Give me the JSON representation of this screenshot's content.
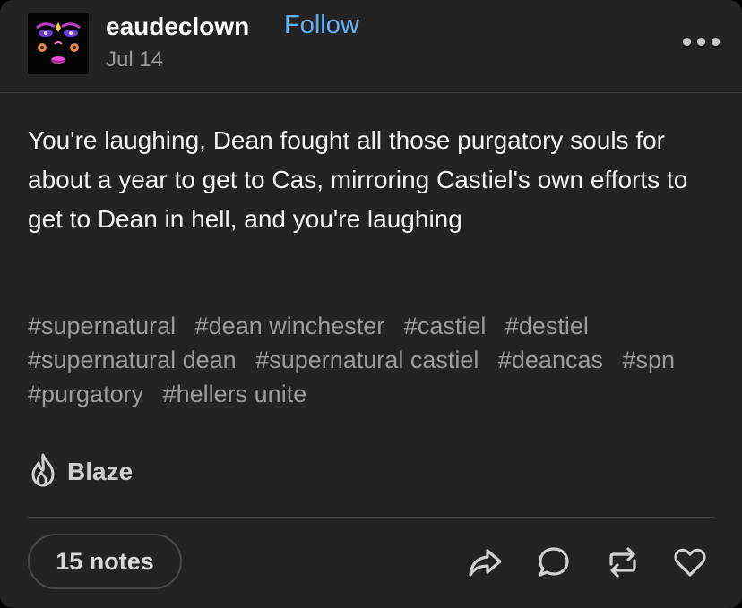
{
  "post": {
    "author": "eaudeclown",
    "follow_label": "Follow",
    "date": "Jul 14",
    "body": "You're laughing, Dean fought all those purgatory souls for about a year to get to Cas, mirroring Castiel's own efforts to get to Dean in hell, and you're laughing",
    "tags": [
      "#supernatural",
      "#dean winchester",
      "#castiel",
      "#destiel",
      "#supernatural dean",
      "#supernatural castiel",
      "#deancas",
      "#spn",
      "#purgatory",
      "#hellers unite"
    ]
  },
  "footer": {
    "blaze_label": "Blaze",
    "notes_label": "15 notes"
  },
  "icons": {
    "more": "more-horizontal-icon",
    "blaze": "flame-icon",
    "share": "share-arrow-icon",
    "reply": "speech-bubble-icon",
    "reblog": "reblog-icon",
    "like": "heart-icon"
  },
  "colors": {
    "card_background": "#232323",
    "follow_link": "#5fb4ff",
    "tag_text": "#9c9c9c"
  }
}
